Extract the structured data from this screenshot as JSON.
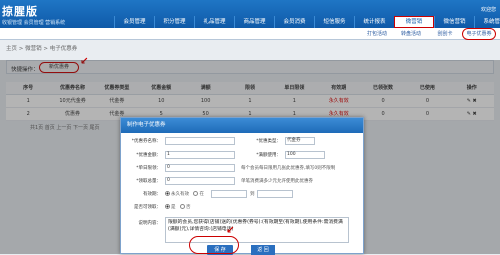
{
  "brand": {
    "name": "掠腥版",
    "slogan": "收银管理 会员管理 营销系统"
  },
  "nav": {
    "items": [
      "会员管理",
      "积分管理",
      "礼品管理",
      "商品管理",
      "会员消费",
      "短信服务",
      "统计报表",
      "微营销"
    ],
    "active_index": 7,
    "right_items": [
      "微信营销",
      "系统管理"
    ],
    "user_text": "欢迎您"
  },
  "subnav": {
    "items": [
      "打包活动",
      "转盘活动",
      "刮刮卡",
      "电子优惠券"
    ],
    "active_index": 3
  },
  "breadcrumb": "主页 > 微营销 > 电子优惠券",
  "quickbar": {
    "label": "快捷操作：",
    "button": "新优惠券"
  },
  "grid": {
    "headers": [
      "序号",
      "优惠券名称",
      "优惠券类型",
      "优惠金额",
      "满额",
      "限领",
      "单日限领",
      "有效期",
      "已领张数",
      "已使用",
      "操作"
    ],
    "rows": [
      [
        "1",
        "10元代金券",
        "代金券",
        "10",
        "100",
        "1",
        "1",
        "永久有效",
        "0",
        "0",
        ""
      ],
      [
        "2",
        "优惠券",
        "代金券",
        "5",
        "50",
        "1",
        "1",
        "永久有效",
        "0",
        "0",
        ""
      ]
    ]
  },
  "pager": "共1页 首页 上一页 下一页 尾页",
  "dialog": {
    "title": "制作电子优惠券",
    "name_label": "*优惠券名称：",
    "type_label": "*优惠类型：",
    "type_value": "代金券",
    "amount_label": "*优惠金额：",
    "amount_value": "1",
    "limit_label": "*满额使用：",
    "limit_value": "100",
    "daily_label": "*单日限领：",
    "daily_value": "0",
    "daily_hint": "每个会员每日限用几张此优惠券,填写0则不限制",
    "total_label": "*领取总量：",
    "total_value": "0",
    "total_hint": "单笔消费满多少元允许使用此优惠券",
    "valid_label": "有效期：",
    "valid_option_forever": "永久有效",
    "valid_option_range": "在",
    "valid_to": "到",
    "show_label": "是否可领取：",
    "show_yes": "是",
    "show_no": "否",
    "desc_label": "说明内容：",
    "desc_text": "限额的会员,您获得(店铺)送的(优惠券(券号):(有效期至(有效期),使用条件:需消费满(满额)元),详情咨询:(店铺电话)",
    "save_label": "保 存",
    "return_label": "返 回"
  },
  "colors": {
    "accent": "#1e6bb8",
    "highlight": "#cc0000"
  }
}
